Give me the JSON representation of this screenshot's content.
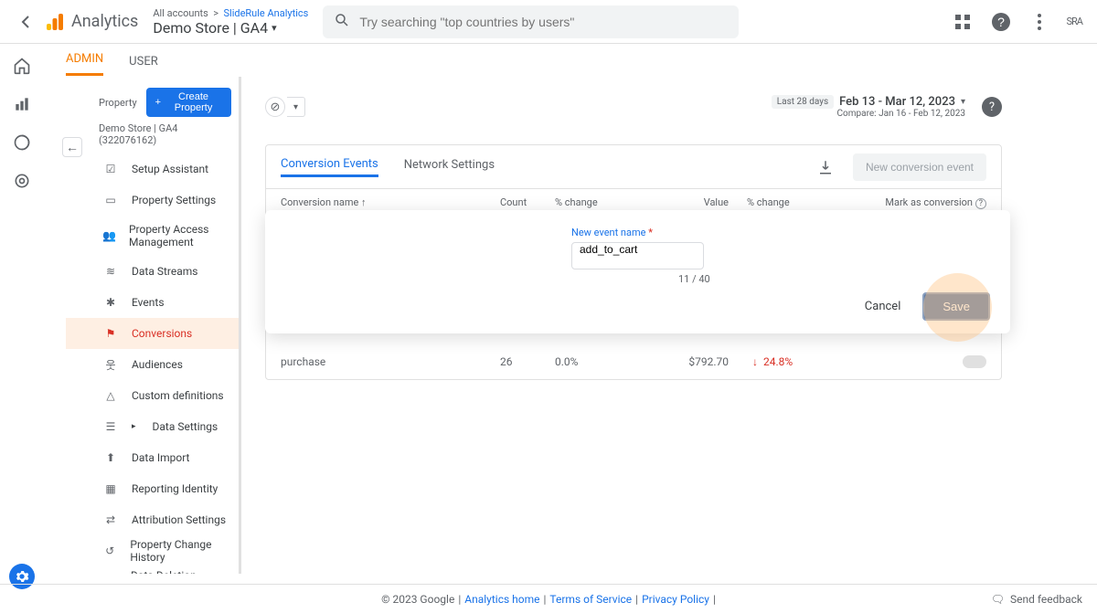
{
  "header": {
    "product_name": "Analytics",
    "breadcrumb_small_a": "All accounts",
    "breadcrumb_small_b": "SlideRule Analytics",
    "breadcrumb_large": "Demo Store | GA4",
    "search_placeholder": "Try searching \"top countries by users\""
  },
  "topright": {
    "avatar": "SRA"
  },
  "tabs": {
    "admin": "ADMIN",
    "user": "USER"
  },
  "sidebar": {
    "section_label": "Property",
    "create_button": "Create Property",
    "property_id": "Demo Store | GA4 (322076162)",
    "items": [
      "Setup Assistant",
      "Property Settings",
      "Property Access Management",
      "Data Streams",
      "Events",
      "Conversions",
      "Audiences",
      "Custom definitions",
      "Data Settings",
      "Data Import",
      "Reporting Identity",
      "Attribution Settings",
      "Property Change History",
      "Data Deletion Requests"
    ]
  },
  "daterange": {
    "chip": "Last 28 days",
    "main": "Feb 13 - Mar 12, 2023",
    "compare": "Compare: Jan 16 - Feb 12, 2023"
  },
  "table": {
    "tabs": {
      "conversion": "Conversion Events",
      "network": "Network Settings"
    },
    "new_button": "New conversion event",
    "headers": {
      "name": "Conversion name",
      "count": "Count",
      "pct_change": "% change",
      "value": "Value",
      "pct_change2": "% change",
      "mark": "Mark as conversion"
    },
    "row": {
      "name": "purchase",
      "count": "26",
      "pct_change": "0.0%",
      "value": "$792.70",
      "pct_change2": "24.8%"
    }
  },
  "dialog": {
    "label": "New event name",
    "value": "add_to_cart",
    "counter": "11 / 40",
    "cancel": "Cancel",
    "save": "Save"
  },
  "footer": {
    "copyright": "© 2023 Google",
    "links": [
      "Analytics home",
      "Terms of Service",
      "Privacy Policy"
    ],
    "feedback": "Send feedback"
  }
}
